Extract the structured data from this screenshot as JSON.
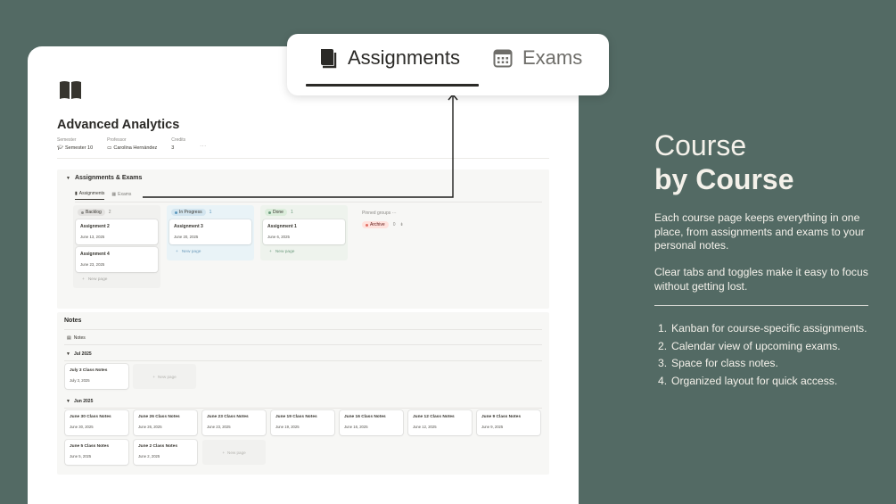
{
  "page": {
    "title": "Advanced Analytics",
    "properties": [
      {
        "name": "Semester",
        "value": "Semester 10",
        "icon": "graduation-cap-icon"
      },
      {
        "name": "Professor",
        "value": "Carolina Hernández",
        "icon": "id-card-icon"
      },
      {
        "name": "Credits",
        "value": "3"
      }
    ],
    "more": "···"
  },
  "assignments_section": {
    "title": "Assignments & Exams",
    "tabs": [
      {
        "label": "Assignments",
        "icon": "book-icon",
        "active": true
      },
      {
        "label": "Exams",
        "icon": "calendar-icon",
        "active": false
      }
    ],
    "columns": [
      {
        "label": "Backlog",
        "count": "2",
        "pill_color": "#e3e2e0",
        "dot_color": "#91918e",
        "bg": "#f1f1ef",
        "cards": [
          {
            "title": "Assignment 2",
            "date": "June 13, 2025"
          },
          {
            "title": "Assignment 4",
            "date": "June 23, 2025"
          }
        ],
        "new_page": "New page"
      },
      {
        "label": "In Progress",
        "count": "1",
        "pill_color": "#d3e5ef",
        "dot_color": "#5b97bd",
        "bg": "#e9f3f7",
        "cards": [
          {
            "title": "Assignment 3",
            "date": "June 20, 2025"
          }
        ],
        "new_page": "New page"
      },
      {
        "label": "Done",
        "count": "1",
        "pill_color": "#dbeddb",
        "dot_color": "#6c9b7d",
        "bg": "#eef3ed",
        "cards": [
          {
            "title": "Assignment 1",
            "date": "June 6, 2025"
          }
        ],
        "new_page": "New page"
      }
    ],
    "hidden_groups_label": "Pinned groups",
    "hidden_groups_more": "···",
    "archive": {
      "label": "Archive",
      "count": "0",
      "pill_color": "#ffe2dd",
      "dot_color": "#e16f64"
    }
  },
  "notes_section": {
    "title": "Notes",
    "tab_label": "Notes",
    "groups": [
      {
        "label": "Jul 2025",
        "cards": [
          {
            "title": "July 3 Class Notes",
            "date": "July 3, 2025"
          }
        ],
        "new_page": "New page"
      },
      {
        "label": "Jun 2025",
        "cards": [
          {
            "title": "June 30 Class Notes",
            "date": "June 30, 2025"
          },
          {
            "title": "June 26 Class Notes",
            "date": "June 26, 2025"
          },
          {
            "title": "June 23 Class Notes",
            "date": "June 23, 2025"
          },
          {
            "title": "June 19 Class Notes",
            "date": "June 19, 2025"
          },
          {
            "title": "June 16 Class Notes",
            "date": "June 16, 2025"
          },
          {
            "title": "June 12 Class Notes",
            "date": "June 12, 2025"
          },
          {
            "title": "June 9 Class Notes",
            "date": "June 9, 2025"
          },
          {
            "title": "June 5 Class Notes",
            "date": "June 5, 2025"
          },
          {
            "title": "June 2 Class Notes",
            "date": "June 2, 2025"
          }
        ],
        "new_page": "New page"
      }
    ]
  },
  "callout": {
    "tabs": [
      {
        "label": "Assignments",
        "icon": "book-icon",
        "active": true
      },
      {
        "label": "Exams",
        "icon": "calendar-icon",
        "active": false
      }
    ]
  },
  "promo": {
    "headline_line1": "Course",
    "headline_line2": "by Course",
    "paragraph1": "Each course page keeps everything in one place, from assignments and exams to your personal notes.",
    "paragraph2": "Clear tabs and toggles make it easy to focus without getting lost.",
    "features": [
      "Kanban for course-specific assignments.",
      "Calendar view of upcoming exams.",
      "Space for class notes.",
      "Organized layout for quick access."
    ]
  },
  "colors": {
    "background": "#536a64",
    "text_light": "#f4f1ea"
  }
}
